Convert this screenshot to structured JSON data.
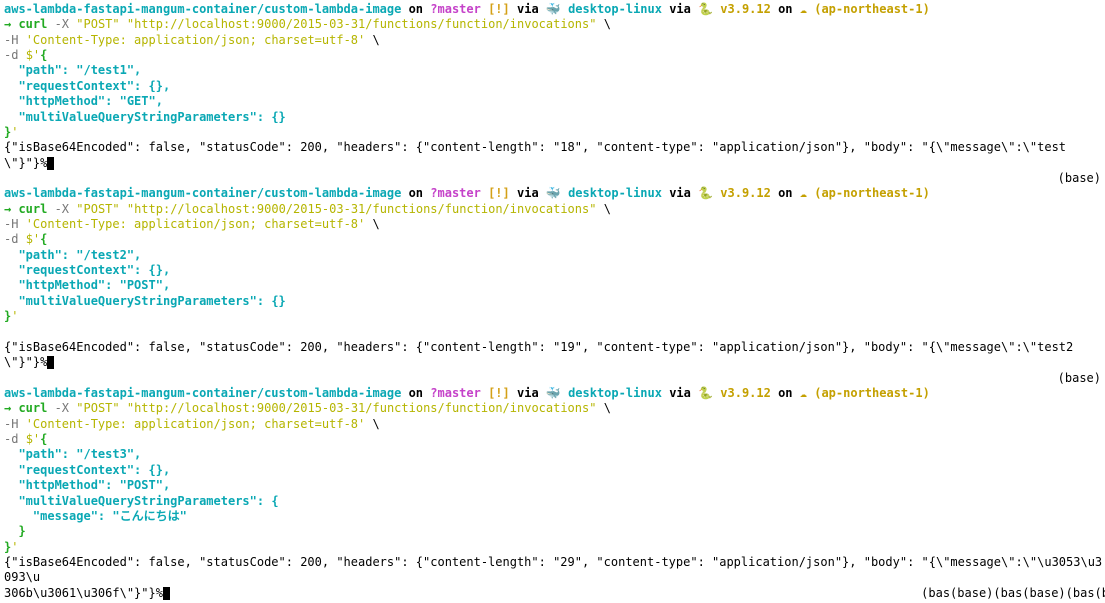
{
  "prompt": {
    "path": "aws-lambda-fastapi-mangum-container/custom-lambda-image",
    "on": " on ",
    "branch": "?master",
    "excl": "[!]",
    "via1": " via ",
    "docker": "desktop-linux",
    "via2": " via ",
    "python": "v3.9.12",
    "onRegion": " on ",
    "region": "(ap-northeast-1)"
  },
  "cmd": {
    "arrow": "→ ",
    "curl": "curl",
    "dashX": " -X ",
    "post": "\"POST\"",
    "url": "\"http://localhost:9000/2015-03-31/functions/function/invocations\"",
    "bs": " \\",
    "dashH": "-H ",
    "hval": "'Content-Type: application/json; charset=utf-8'",
    "dashD": "-d ",
    "dollar": "$'",
    "openBrace": "{",
    "closeBrace": "}",
    "closeQuote": "'"
  },
  "body1": {
    "l1": "  \"path\": \"/test1\",",
    "l2": "  \"requestContext\": {},",
    "l3": "  \"httpMethod\": \"GET\",",
    "l4": "  \"multiValueQueryStringParameters\": {}"
  },
  "body2": {
    "l1": "  \"path\": \"/test2\",",
    "l2": "  \"requestContext\": {},",
    "l3": "  \"httpMethod\": \"POST\",",
    "l4": "  \"multiValueQueryStringParameters\": {}"
  },
  "body3": {
    "l1": "  \"path\": \"/test3\",",
    "l2": "  \"requestContext\": {},",
    "l3": "  \"httpMethod\": \"POST\",",
    "l4": "  \"multiValueQueryStringParameters\": {",
    "l5": "    \"message\": \"こんにちは\"",
    "l6": "  }"
  },
  "resp1": "{\"isBase64Encoded\": false, \"statusCode\": 200, \"headers\": {\"content-length\": \"18\", \"content-type\": \"application/json\"}, \"body\": \"{\\\"message\\\":\\\"test\\\"}\"}%",
  "resp2": "{\"isBase64Encoded\": false, \"statusCode\": 200, \"headers\": {\"content-length\": \"19\", \"content-type\": \"application/json\"}, \"body\": \"{\\\"message\\\":\\\"test2\\\"}\"}%",
  "resp3a": "{\"isBase64Encoded\": false, \"statusCode\": 200, \"headers\": {\"content-length\": \"29\", \"content-type\": \"application/json\"}, \"body\": \"{\\\"message\\\":\\\"\\u3053\\u3093\\u",
  "resp3b": "306b\\u3061\\u306f\\\"}\"}%",
  "baseTag": "(base)",
  "baseTag3": "(bas(base)(bas(base)(bas(b"
}
